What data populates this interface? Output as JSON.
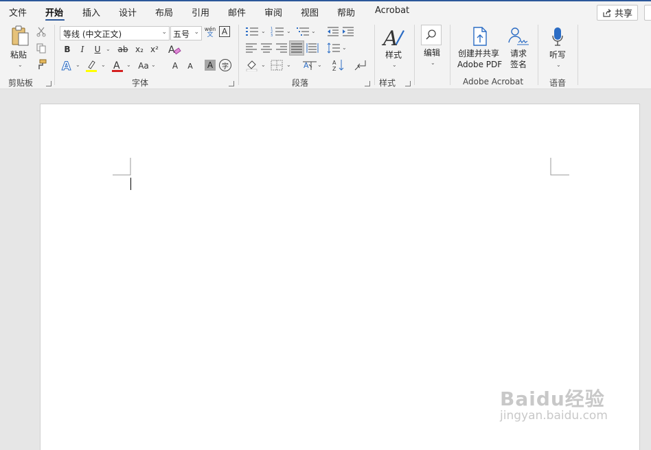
{
  "tabs": [
    "文件",
    "开始",
    "插入",
    "设计",
    "布局",
    "引用",
    "邮件",
    "审阅",
    "视图",
    "帮助",
    "Acrobat"
  ],
  "active_tab": "开始",
  "share_label": "共享",
  "clipboard": {
    "paste_label": "粘贴",
    "group_label": "剪贴板"
  },
  "font": {
    "family_value": "等线 (中文正文)",
    "size_value": "五号",
    "group_label": "字体",
    "bold": "B",
    "italic": "I",
    "underline": "U",
    "strike": "ab",
    "subscript": "x₂",
    "superscript": "x²",
    "change_case": "Aa",
    "grow": "A",
    "shrink": "A",
    "char_shading": "A",
    "enclose": "字",
    "pinyin_top": "wén",
    "pinyin_bottom": "文",
    "char_border": "A",
    "colors": {
      "highlight": "#ffff00",
      "font_color": "#d42020",
      "text_effect": "#2b6cc4"
    }
  },
  "paragraph": {
    "group_label": "段落"
  },
  "styles": {
    "button_label": "样式",
    "group_label": "样式"
  },
  "editing": {
    "button_label": "编辑"
  },
  "acrobat": {
    "create_share_line1": "创建并共享",
    "create_share_line2": "Adobe PDF",
    "request_sign_line1": "请求",
    "request_sign_line2": "签名",
    "group_label": "Adobe Acrobat"
  },
  "voice": {
    "dictate_label": "听写",
    "group_label": "语音"
  },
  "watermark": {
    "main": "Baidu经验",
    "sub": "jingyan.baidu.com"
  },
  "accent_color": "#2b579a"
}
